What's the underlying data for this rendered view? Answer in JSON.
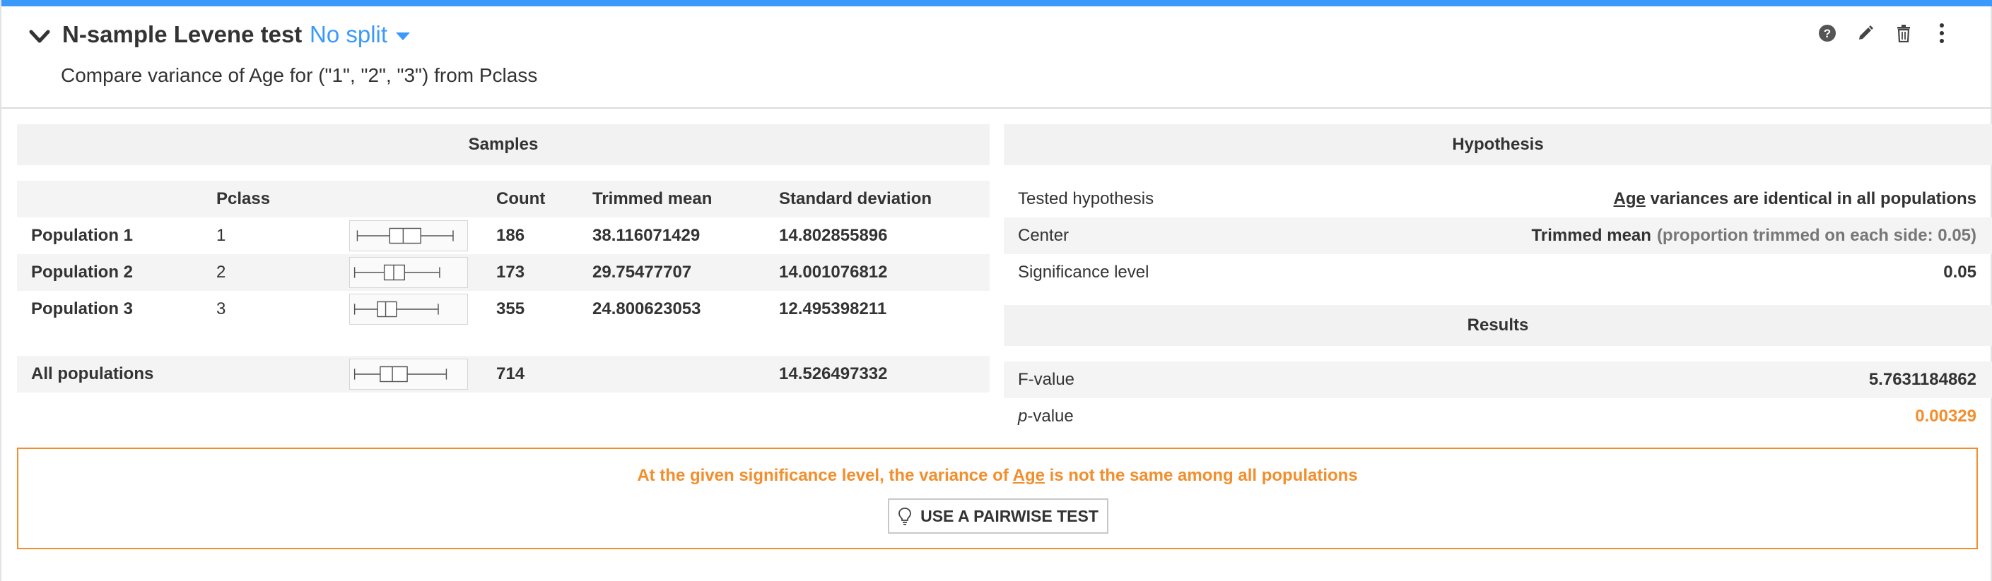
{
  "header": {
    "title": "N-sample Levene test",
    "split_label": "No split",
    "subtitle": "Compare variance of Age for (\"1\", \"2\", \"3\") from Pclass",
    "actions": [
      "help-icon",
      "edit-icon",
      "trash-icon",
      "more-icon"
    ]
  },
  "samples": {
    "section_title": "Samples",
    "columns": {
      "pclass": "Pclass",
      "count": "Count",
      "trimmed_mean": "Trimmed mean",
      "std_dev": "Standard deviation"
    },
    "rows": [
      {
        "label": "Population 1",
        "pclass": "1",
        "count": "186",
        "trimmed_mean": "38.116071429",
        "std_dev": "14.802855896"
      },
      {
        "label": "Population 2",
        "pclass": "2",
        "count": "173",
        "trimmed_mean": "29.75477707",
        "std_dev": "14.001076812"
      },
      {
        "label": "Population 3",
        "pclass": "3",
        "count": "355",
        "trimmed_mean": "24.800623053",
        "std_dev": "12.495398211"
      }
    ],
    "all": {
      "label": "All populations",
      "count": "714",
      "std_dev": "14.526497332"
    }
  },
  "hypothesis": {
    "section_title": "Hypothesis",
    "tested_label": "Tested hypothesis",
    "tested_var": "Age",
    "tested_value": "variances are identical in all populations",
    "center_label": "Center",
    "center_value": "Trimmed mean",
    "center_note": "(proportion trimmed on each side: 0.05)",
    "sig_label": "Significance level",
    "sig_value": "0.05"
  },
  "results": {
    "section_title": "Results",
    "f_label": "F-value",
    "f_value": "5.7631184862",
    "p_label_italic": "p",
    "p_label_rest": "-value",
    "p_value": "0.00329"
  },
  "conclusion": {
    "text_before": "At the given significance level, the variance of",
    "var": "Age",
    "text_after": "is not the same among all populations",
    "button_label": "USE A PAIRWISE TEST"
  },
  "colors": {
    "accent": "#3b99fc",
    "warning": "#f28e2c"
  }
}
